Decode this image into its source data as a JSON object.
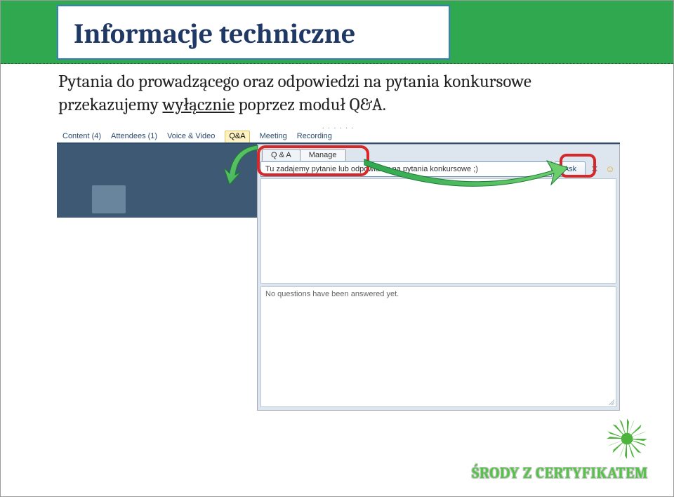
{
  "header": {
    "title": "Informacje techniczne"
  },
  "description": {
    "text_before": "Pytania do prowadzącego oraz odpowiedzi na pytania konkursowe przekazujemy ",
    "underlined": "wyłącznie",
    "text_after": " poprzez moduł Q&A."
  },
  "app": {
    "menubar": [
      {
        "label": "Content (4)",
        "selected": false
      },
      {
        "label": "Attendees (1)",
        "selected": false
      },
      {
        "label": "Voice & Video",
        "selected": false
      },
      {
        "label": "Q&A",
        "selected": true
      },
      {
        "label": "Meeting",
        "selected": false
      },
      {
        "label": "Recording",
        "selected": false
      }
    ],
    "tabs": {
      "qa": "Q & A",
      "manage": "Manage"
    },
    "qa_input_value": "Tu zadajemy pytanie lub odpowiamy na pytania konkursowe ;)",
    "ask_label": "Ask",
    "close_glyph": "✕",
    "emoji_glyph": "☺",
    "answered_placeholder": "No questions have been answered yet.",
    "handle_dots": "· · · · · ·"
  },
  "footer": {
    "brand_text": "ŚRODY Z CERTYFIKATEM"
  },
  "colors": {
    "accent_green": "#2fa84f",
    "highlight_red": "#d62729",
    "brand_green": "#57c24a"
  }
}
